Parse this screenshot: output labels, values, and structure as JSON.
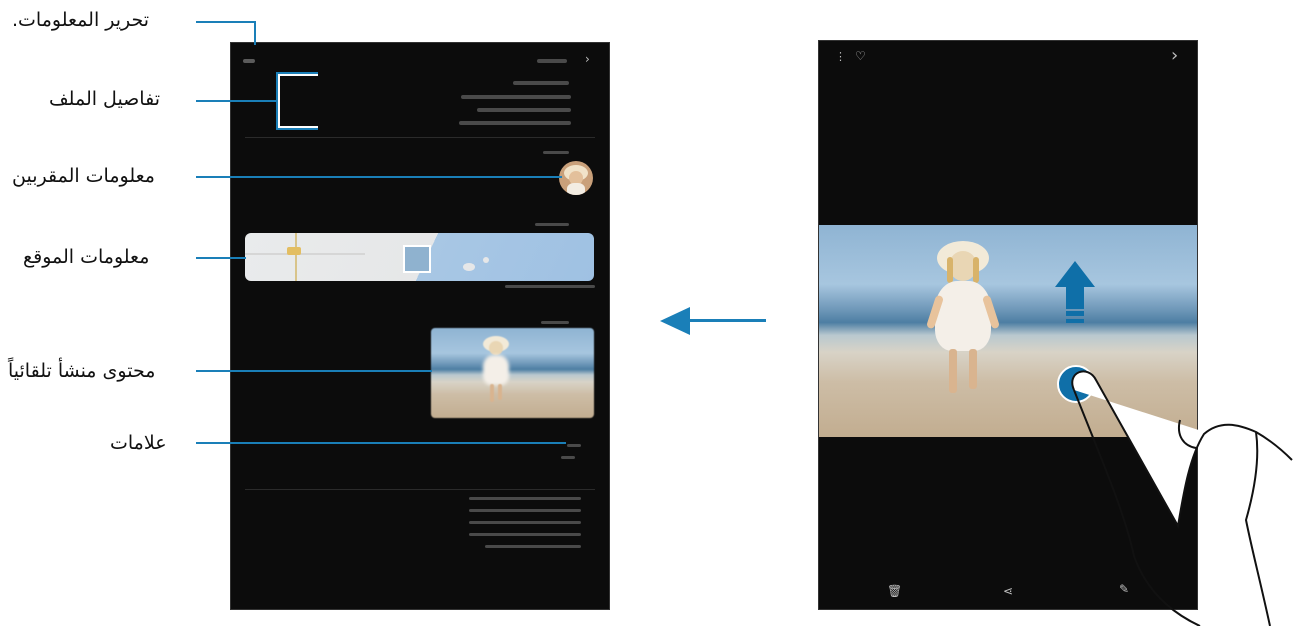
{
  "callouts": {
    "edit_info": "تحرير المعلومات.",
    "file_details": "تفاصيل الملف",
    "people_info": "معلومات المقربين",
    "location_info": "معلومات الموقع",
    "auto_content": "محتوى منشأ تلقائياً",
    "tags": "علامات"
  },
  "colors": {
    "accent": "#1a7fb8",
    "screen_bg": "#0c0c0c"
  },
  "icons": {
    "more": "more-vertical-icon",
    "favorite": "heart-icon",
    "next": "chevron-right-icon",
    "delete": "trash-icon",
    "share": "share-icon",
    "edit": "pencil-icon",
    "swipe_up": "arrow-up-icon",
    "navigate": "arrow-left-icon"
  }
}
